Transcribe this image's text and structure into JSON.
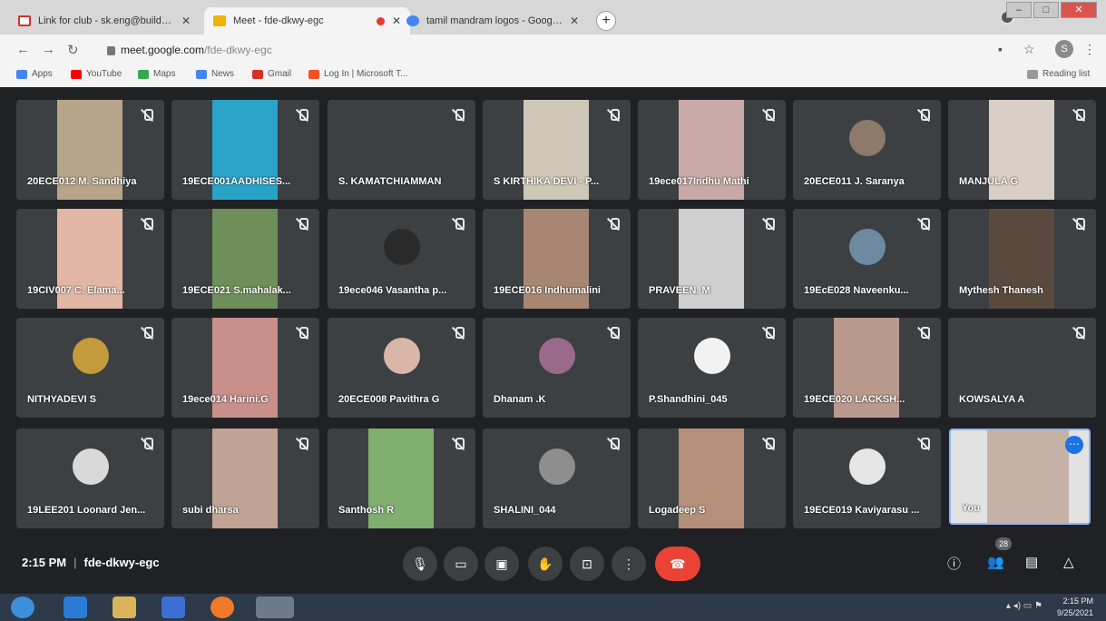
{
  "browser": {
    "tabs": [
      {
        "title": "Link for club - sk.eng@builders.i",
        "icon": "gmail-icon",
        "active": false
      },
      {
        "title": "Meet - fde-dkwy-egc",
        "icon": "meet-icon",
        "active": true
      },
      {
        "title": "tamil mandram logos - Google S",
        "icon": "google-icon",
        "active": false
      }
    ],
    "url_host": "meet.google.com",
    "url_path": "/fde-dkwy-egc",
    "profile_initial": "S",
    "bookmarks": [
      {
        "label": "Apps",
        "color": "#4285f4"
      },
      {
        "label": "YouTube",
        "color": "#ff0000"
      },
      {
        "label": "Maps",
        "color": "#34a853"
      },
      {
        "label": "News",
        "color": "#4285f4"
      },
      {
        "label": "Gmail",
        "color": "#d93025"
      },
      {
        "label": "Log In | Microsoft T...",
        "color": "#f25022"
      }
    ],
    "reading_list": "Reading list"
  },
  "meet": {
    "participants": [
      {
        "name": "20ECE012 M. Sandhiya",
        "kind": "photo",
        "color": "#b7a58a"
      },
      {
        "name": "19ECE001AADHISES...",
        "kind": "photo",
        "color": "#2aa3c9"
      },
      {
        "name": "S. KAMATCHIAMMAN",
        "kind": "empty",
        "color": "#3c4043"
      },
      {
        "name": "S KIRTHIKA DEVI - P...",
        "kind": "photo",
        "color": "#cfc8b8"
      },
      {
        "name": "19ece017Indhu Mathi",
        "kind": "photo",
        "color": "#c9a9a6"
      },
      {
        "name": "20ECE011 J. Saranya",
        "kind": "avatar",
        "color": "#8d7a6a"
      },
      {
        "name": "MANJULA G",
        "kind": "photo",
        "color": "#d9cfc5"
      },
      {
        "name": "19CIV007 C. Elama...",
        "kind": "photo",
        "color": "#e2b6a4"
      },
      {
        "name": "19ECE021 S.mahalak...",
        "kind": "photo",
        "color": "#6f8f5a"
      },
      {
        "name": "19ece046 Vasantha p...",
        "kind": "avatar",
        "color": "#2a2a2a"
      },
      {
        "name": "19ECE016 Indhumalini",
        "kind": "photo",
        "color": "#a88772"
      },
      {
        "name": "PRAVEEN. M",
        "kind": "photo",
        "color": "#cfcfcf"
      },
      {
        "name": "19EcE028 Naveenku...",
        "kind": "avatar",
        "color": "#6e8aa0"
      },
      {
        "name": "Mythesh Thanesh",
        "kind": "photo",
        "color": "#5a4a3e"
      },
      {
        "name": "NITHYADEVI S",
        "kind": "avatar",
        "color": "#c59a3a"
      },
      {
        "name": "19ece014 Harini.G",
        "kind": "photo",
        "color": "#c98f8a"
      },
      {
        "name": "20ECE008 Pavithra G",
        "kind": "avatar",
        "color": "#d8b7a8"
      },
      {
        "name": "Dhanam .K",
        "kind": "avatar",
        "color": "#9a6a8a"
      },
      {
        "name": "P.Shandhini_045",
        "kind": "avatar",
        "color": "#f2f2f2"
      },
      {
        "name": "19ECE020 LACKSH...",
        "kind": "photo",
        "color": "#b99a8c"
      },
      {
        "name": "KOWSALYA A",
        "kind": "avatar",
        "color": "#3c4043"
      },
      {
        "name": "19LEE201 Loonard Jen...",
        "kind": "avatar",
        "color": "#d9d9d9"
      },
      {
        "name": "subi dharsa",
        "kind": "photo",
        "color": "#c0a394"
      },
      {
        "name": "Santhosh R",
        "kind": "photo",
        "color": "#7fae6e"
      },
      {
        "name": "SHALINI_044",
        "kind": "avatar",
        "color": "#8e8e8e"
      },
      {
        "name": "Logadeep S",
        "kind": "photo",
        "color": "#b58f7a"
      },
      {
        "name": "19ECE019 Kaviyarasu ...",
        "kind": "avatar",
        "color": "#e6e6e6"
      }
    ],
    "self_label": "You",
    "time": "2:15 PM",
    "meeting_code": "fde-dkwy-egc",
    "participant_count": "28"
  },
  "taskbar": {
    "time": "2:15 PM",
    "date": "9/25/2021"
  }
}
